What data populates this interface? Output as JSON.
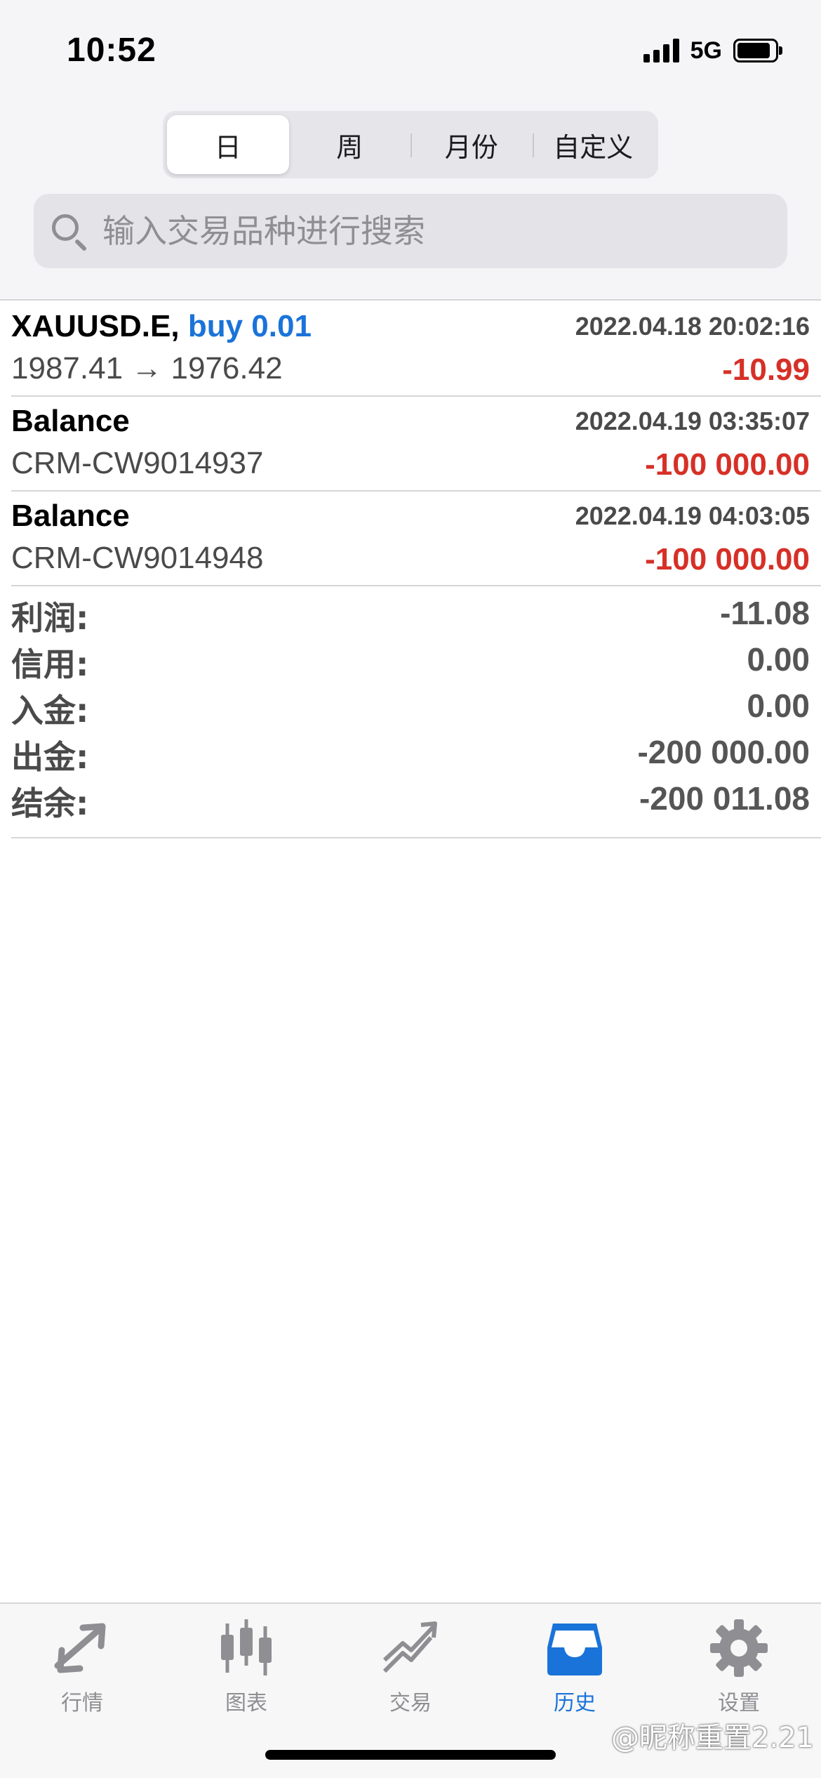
{
  "status_bar": {
    "time": "10:52",
    "network": "5G"
  },
  "segments": [
    {
      "label": "日",
      "active": true
    },
    {
      "label": "周",
      "active": false
    },
    {
      "label": "月份",
      "active": false
    },
    {
      "label": "自定义",
      "active": false
    }
  ],
  "search": {
    "placeholder": "输入交易品种进行搜索",
    "value": ""
  },
  "history": [
    {
      "symbol": "XAUUSD.E,",
      "action": "buy 0.01",
      "time": "2022.04.18 20:02:16",
      "detail": "1987.41 → 1976.42",
      "amount": "-10.99"
    },
    {
      "symbol": "Balance",
      "action": "",
      "time": "2022.04.19 03:35:07",
      "detail": "CRM-CW9014937",
      "amount": "-100 000.00"
    },
    {
      "symbol": "Balance",
      "action": "",
      "time": "2022.04.19 04:03:05",
      "detail": "CRM-CW9014948",
      "amount": "-100 000.00"
    }
  ],
  "summary": [
    {
      "label": "利润:",
      "value": "-11.08"
    },
    {
      "label": "信用:",
      "value": "0.00"
    },
    {
      "label": "入金:",
      "value": "0.00"
    },
    {
      "label": "出金:",
      "value": "-200 000.00"
    },
    {
      "label": "结余:",
      "value": "-200 011.08"
    }
  ],
  "tabs": [
    {
      "label": "行情",
      "icon": "quotes-arrows-icon",
      "active": false
    },
    {
      "label": "图表",
      "icon": "candlestick-chart-icon",
      "active": false
    },
    {
      "label": "交易",
      "icon": "trade-trend-icon",
      "active": false
    },
    {
      "label": "历史",
      "icon": "history-inbox-icon",
      "active": true
    },
    {
      "label": "设置",
      "icon": "gear-icon",
      "active": false
    }
  ],
  "watermark": "@昵称重置2.21",
  "colors": {
    "accent": "#1a73d9",
    "loss": "#d63027",
    "inactive_tab": "#8e8e93"
  }
}
